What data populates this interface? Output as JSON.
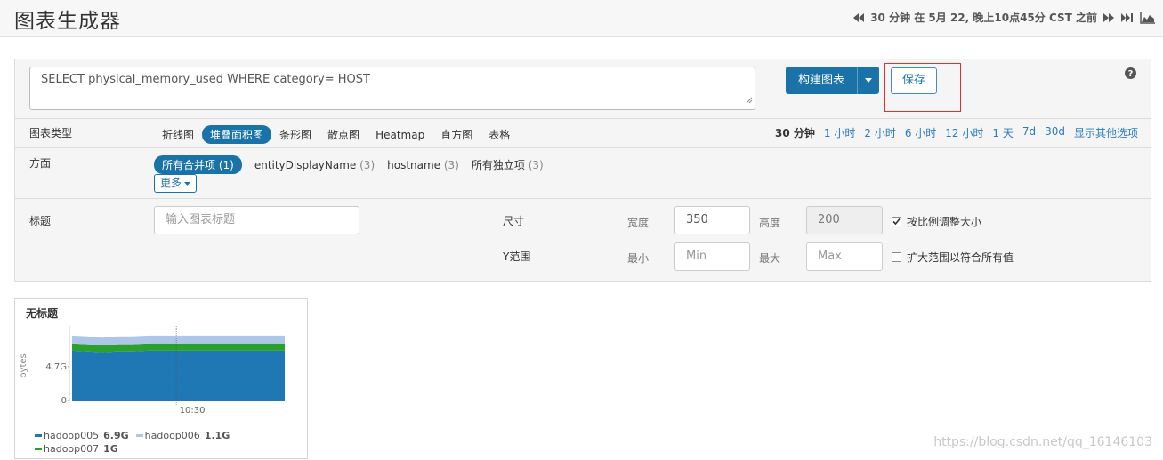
{
  "header": {
    "title": "图表生成器",
    "time_text": "30 分钟 在 5月 22, 晚上10点45分 CST 之前",
    "icons": [
      "rewind-icon",
      "fast-forward-icon",
      "skip-to-end-icon",
      "area-chart-icon"
    ]
  },
  "query": {
    "text": "SELECT physical_memory_used WHERE category= HOST",
    "build_label": "构建图表",
    "save_label": "保存"
  },
  "chart_type_row": {
    "label": "图表类型",
    "types": [
      "折线图",
      "堆叠面积图",
      "条形图",
      "散点图",
      "Heatmap",
      "直方图",
      "表格"
    ],
    "active_type": "堆叠面积图",
    "ranges": [
      "30 分钟",
      "1 小时",
      "2 小时",
      "6 小时",
      "12 小时",
      "1 天",
      "7d",
      "30d",
      "显示其他选项"
    ],
    "active_range": "30 分钟"
  },
  "facets_row": {
    "label": "方面",
    "items": [
      {
        "name": "所有合并项",
        "count": "(1)"
      },
      {
        "name": "entityDisplayName",
        "count": "(3)"
      },
      {
        "name": "hostname",
        "count": "(3)"
      },
      {
        "name": "所有独立项",
        "count": "(3)"
      }
    ],
    "more_label": "更多"
  },
  "title_row": {
    "label": "标题",
    "title_placeholder": "输入图表标题",
    "size_label": "尺寸",
    "width_label": "宽度",
    "width_value": "350",
    "height_label": "高度",
    "height_value": "200",
    "keep_ratio_label": "按比例调整大小",
    "keep_ratio_checked": true,
    "y_range_label": "Y范围",
    "min_label": "最小",
    "min_placeholder": "Min",
    "max_label": "最大",
    "max_placeholder": "Max",
    "expand_label": "扩大范围以符合所有值",
    "expand_checked": false
  },
  "chart_card": {
    "title": "无标题"
  },
  "chart_data": {
    "type": "area",
    "stacked": true,
    "ylabel": "bytes",
    "y_ticks": [
      "0",
      "4.7G"
    ],
    "y_tick_values": [
      0,
      4.7
    ],
    "ylim": [
      0,
      9.6
    ],
    "x_ticks": [
      "10:30"
    ],
    "series": [
      {
        "name": "hadoop005",
        "label": "6.9G",
        "color": "#1f77b4",
        "values": [
          6.9,
          6.8,
          6.7,
          6.8,
          6.8,
          6.9,
          6.9,
          6.9,
          6.9,
          6.9,
          6.9,
          6.9,
          6.9,
          6.9,
          6.9
        ]
      },
      {
        "name": "hadoop006",
        "label": "1.1G",
        "color": "#aec7e8",
        "values": [
          1.1,
          1.1,
          1.0,
          1.1,
          1.1,
          1.1,
          1.1,
          1.1,
          1.1,
          1.1,
          1.1,
          1.1,
          1.1,
          1.1,
          1.1
        ]
      },
      {
        "name": "hadoop007",
        "label": "1G",
        "color": "#2ca02c",
        "values": [
          1.0,
          1.0,
          1.0,
          1.0,
          1.0,
          1.0,
          1.0,
          1.0,
          1.0,
          1.0,
          1.0,
          1.0,
          1.0,
          1.0,
          1.0
        ]
      }
    ],
    "grid": false,
    "legend_position": "bottom"
  },
  "watermark": "https://blog.csdn.net/qq_16146103"
}
